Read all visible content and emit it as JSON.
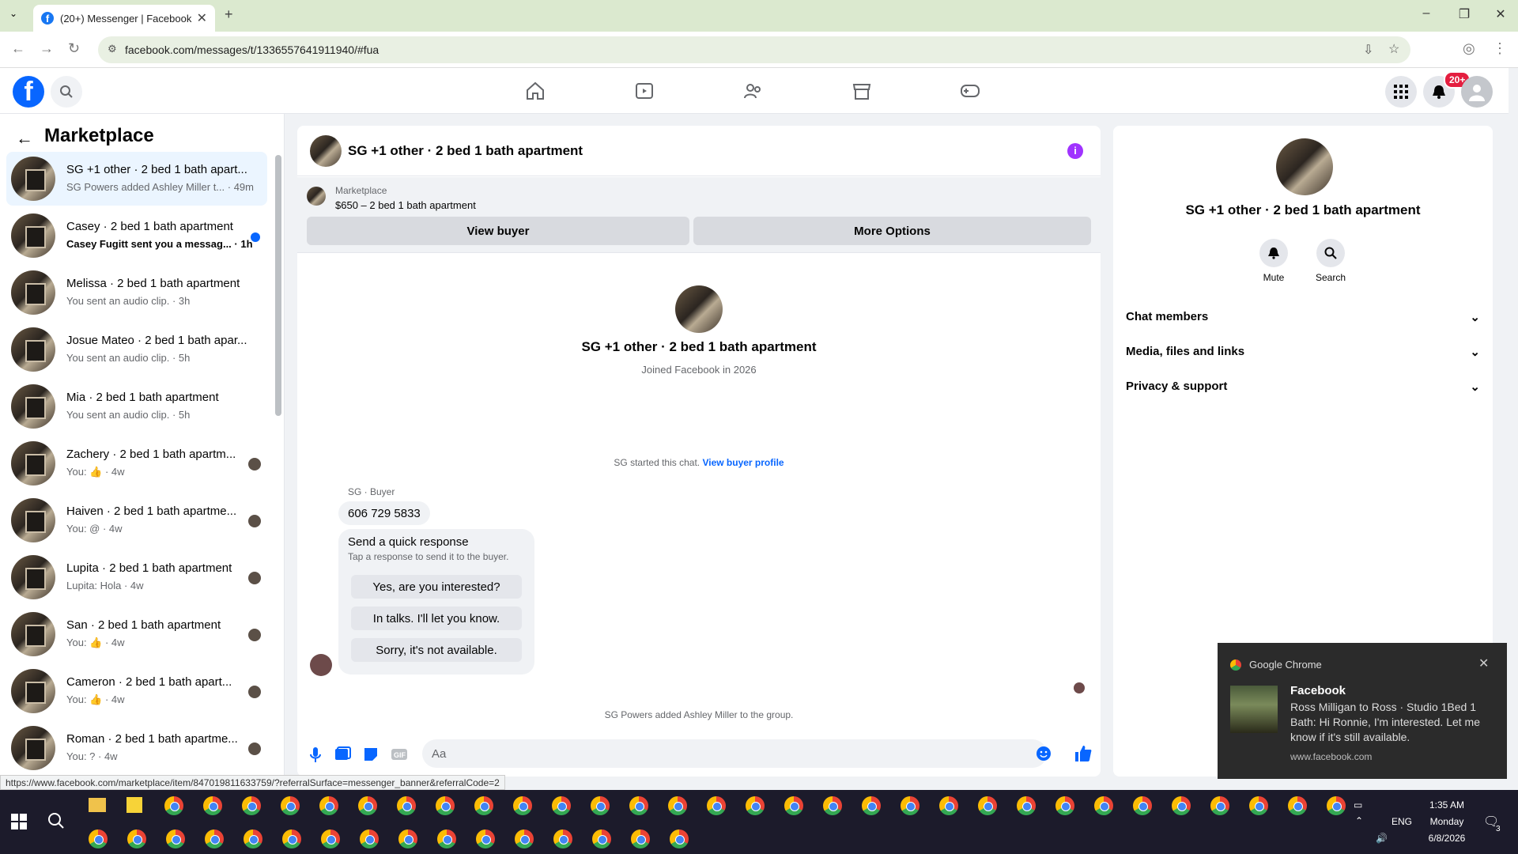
{
  "browser": {
    "tab_title": "(20+) Messenger | Facebook",
    "url": "facebook.com/messages/t/1336557641911940/#fua",
    "status_url": "https://www.facebook.com/marketplace/item/847019811633759/?referralSurface=messenger_banner&referralCode=2"
  },
  "fb": {
    "notif_badge": "20+"
  },
  "sidebar": {
    "title": "Marketplace",
    "conversations": [
      {
        "title": "SG +1 other · 2 bed 1 bath apart...",
        "snippet": "SG Powers added Ashley Miller t... · 49m"
      },
      {
        "title": "Casey · 2 bed 1 bath apartment",
        "snippet": "Casey Fugitt sent you a messag... · 1h"
      },
      {
        "title": "Melissa · 2 bed 1 bath apartment",
        "snippet": "You sent an audio clip. · 3h"
      },
      {
        "title": "Josue Mateo · 2 bed 1 bath apar...",
        "snippet": "You sent an audio clip. · 5h"
      },
      {
        "title": "Mia · 2 bed 1 bath apartment",
        "snippet": "You sent an audio clip. · 5h"
      },
      {
        "title": "Zachery · 2 bed 1 bath apartm...",
        "snippet": "You: 👍 · 4w"
      },
      {
        "title": "Haiven · 2 bed 1 bath apartme...",
        "snippet": "You: @ · 4w"
      },
      {
        "title": "Lupita · 2 bed 1 bath apartment",
        "snippet": "Lupita: Hola · 4w"
      },
      {
        "title": "San · 2 bed 1 bath apartment",
        "snippet": "You: 👍 · 4w"
      },
      {
        "title": "Cameron · 2 bed 1 bath apart...",
        "snippet": "You: 👍 · 4w"
      },
      {
        "title": "Roman · 2 bed 1 bath apartme...",
        "snippet": "You: ? · 4w"
      }
    ]
  },
  "chat": {
    "title": "SG +1 other · 2 bed 1 bath apartment",
    "banner_label": "Marketplace",
    "banner_price": "$650 – 2 bed 1 bath apartment",
    "view_buyer": "View buyer",
    "more_options": "More Options",
    "profile_name": "SG +1 other · 2 bed 1 bath apartment",
    "profile_sub": "Joined Facebook in 2026",
    "started_text": "SG started this chat.",
    "started_link": "View buyer profile",
    "sender": "SG · Buyer",
    "message1": "606 729 5833",
    "qr_title": "Send a quick response",
    "qr_sub": "Tap a response to send it to the buyer.",
    "qr_options": [
      "Yes, are you interested?",
      "In talks. I'll let you know.",
      "Sorry, it's not available."
    ],
    "added_text": "SG Powers added Ashley Miller to the group.",
    "composer_placeholder": "Aa"
  },
  "rpanel": {
    "name": "SG +1 other · 2 bed 1 bath apartment",
    "mute": "Mute",
    "search": "Search",
    "sections": [
      "Chat members",
      "Media, files and links",
      "Privacy & support"
    ]
  },
  "notification": {
    "app": "Google Chrome",
    "title": "Facebook",
    "body": "Ross Milligan to Ross · Studio 1Bed 1 Bath: Hi Ronnie, I'm interested. Let me know if it's still available.",
    "url": "www.facebook.com"
  },
  "taskbar": {
    "time": "1:35 AM",
    "day": "Monday",
    "date": "6/8/2026",
    "lang": "ENG",
    "notif_count": "3"
  },
  "colors": {
    "fb_blue": "#0866ff",
    "accent_purple": "#a033ff",
    "unread_dot": "#0866ff"
  }
}
